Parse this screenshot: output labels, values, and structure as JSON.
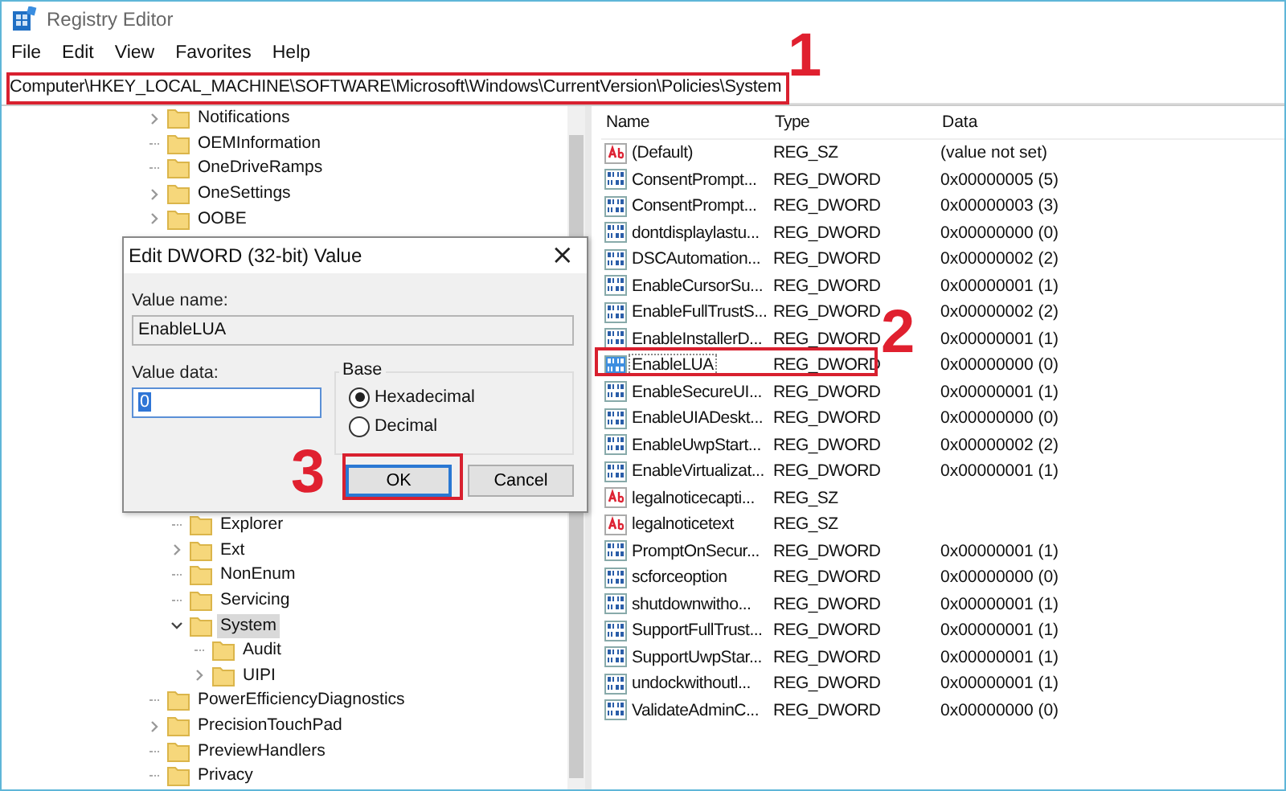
{
  "window": {
    "title": "Registry Editor"
  },
  "menu": [
    "File",
    "Edit",
    "View",
    "Favorites",
    "Help"
  ],
  "address": "Computer\\HKEY_LOCAL_MACHINE\\SOFTWARE\\Microsoft\\Windows\\CurrentVersion\\Policies\\System",
  "tree": {
    "top_items": [
      {
        "label": "Notifications",
        "expandable": true,
        "expanded": false,
        "selected": false
      },
      {
        "label": "OEMInformation",
        "expandable": false,
        "selected": false
      },
      {
        "label": "OneDriveRamps",
        "expandable": false,
        "selected": false
      },
      {
        "label": "OneSettings",
        "expandable": true,
        "expanded": false,
        "selected": false
      },
      {
        "label": "OOBE",
        "expandable": true,
        "expanded": false,
        "selected": false
      }
    ],
    "policies_children": [
      {
        "label": "Explorer",
        "expandable": false,
        "selected": false
      },
      {
        "label": "Ext",
        "expandable": true,
        "expanded": false,
        "selected": false
      },
      {
        "label": "NonEnum",
        "expandable": false,
        "selected": false
      },
      {
        "label": "Servicing",
        "expandable": false,
        "selected": false
      },
      {
        "label": "System",
        "expandable": true,
        "expanded": true,
        "selected": true,
        "children": [
          {
            "label": "Audit",
            "expandable": false,
            "selected": false
          },
          {
            "label": "UIPI",
            "expandable": true,
            "expanded": false,
            "selected": false
          }
        ]
      }
    ],
    "bottom_items": [
      {
        "label": "PowerEfficiencyDiagnostics",
        "expandable": false,
        "selected": false
      },
      {
        "label": "PrecisionTouchPad",
        "expandable": true,
        "expanded": false,
        "selected": false
      },
      {
        "label": "PreviewHandlers",
        "expandable": false,
        "selected": false
      },
      {
        "label": "Privacy",
        "expandable": false,
        "selected": false
      }
    ]
  },
  "values": {
    "columns": [
      "Name",
      "Type",
      "Data"
    ],
    "rows": [
      {
        "kind": "string",
        "name": "(Default)",
        "type": "REG_SZ",
        "data": "(value not set)",
        "selected": false
      },
      {
        "kind": "dword",
        "name": "ConsentPrompt...",
        "type": "REG_DWORD",
        "data": "0x00000005 (5)",
        "selected": false
      },
      {
        "kind": "dword",
        "name": "ConsentPrompt...",
        "type": "REG_DWORD",
        "data": "0x00000003 (3)",
        "selected": false
      },
      {
        "kind": "dword",
        "name": "dontdisplaylastu...",
        "type": "REG_DWORD",
        "data": "0x00000000 (0)",
        "selected": false
      },
      {
        "kind": "dword",
        "name": "DSCAutomation...",
        "type": "REG_DWORD",
        "data": "0x00000002 (2)",
        "selected": false
      },
      {
        "kind": "dword",
        "name": "EnableCursorSu...",
        "type": "REG_DWORD",
        "data": "0x00000001 (1)",
        "selected": false
      },
      {
        "kind": "dword",
        "name": "EnableFullTrustS...",
        "type": "REG_DWORD",
        "data": "0x00000002 (2)",
        "selected": false
      },
      {
        "kind": "dword",
        "name": "EnableInstallerD...",
        "type": "REG_DWORD",
        "data": "0x00000001 (1)",
        "selected": false
      },
      {
        "kind": "dword",
        "name": "EnableLUA",
        "type": "REG_DWORD",
        "data": "0x00000000 (0)",
        "selected": true
      },
      {
        "kind": "dword",
        "name": "EnableSecureUI...",
        "type": "REG_DWORD",
        "data": "0x00000001 (1)",
        "selected": false
      },
      {
        "kind": "dword",
        "name": "EnableUIADeskt...",
        "type": "REG_DWORD",
        "data": "0x00000000 (0)",
        "selected": false
      },
      {
        "kind": "dword",
        "name": "EnableUwpStart...",
        "type": "REG_DWORD",
        "data": "0x00000002 (2)",
        "selected": false
      },
      {
        "kind": "dword",
        "name": "EnableVirtualizat...",
        "type": "REG_DWORD",
        "data": "0x00000001 (1)",
        "selected": false
      },
      {
        "kind": "string",
        "name": "legalnoticecapti...",
        "type": "REG_SZ",
        "selected": false
      },
      {
        "kind": "string",
        "name": "legalnoticetext",
        "type": "REG_SZ",
        "selected": false
      },
      {
        "kind": "dword",
        "name": "PromptOnSecur...",
        "type": "REG_DWORD",
        "data": "0x00000001 (1)",
        "selected": false
      },
      {
        "kind": "dword",
        "name": "scforceoption",
        "type": "REG_DWORD",
        "data": "0x00000000 (0)",
        "selected": false
      },
      {
        "kind": "dword",
        "name": "shutdownwitho...",
        "type": "REG_DWORD",
        "data": "0x00000001 (1)",
        "selected": false
      },
      {
        "kind": "dword",
        "name": "SupportFullTrust...",
        "type": "REG_DWORD",
        "data": "0x00000001 (1)",
        "selected": false
      },
      {
        "kind": "dword",
        "name": "SupportUwpStar...",
        "type": "REG_DWORD",
        "data": "0x00000001 (1)",
        "selected": false
      },
      {
        "kind": "dword",
        "name": "undockwithoutl...",
        "type": "REG_DWORD",
        "data": "0x00000001 (1)",
        "selected": false
      },
      {
        "kind": "dword",
        "name": "ValidateAdminC...",
        "type": "REG_DWORD",
        "data": "0x00000000 (0)",
        "selected": false
      }
    ]
  },
  "dialog": {
    "title": "Edit DWORD (32-bit) Value",
    "close": "×",
    "value_name_label": "Value name:",
    "value_name": "EnableLUA",
    "value_data_label": "Value data:",
    "value_data": "0",
    "base_label": "Base",
    "base_options": [
      {
        "label": "Hexadecimal",
        "selected": true
      },
      {
        "label": "Decimal",
        "selected": false
      }
    ],
    "buttons": [
      {
        "label": "OK",
        "focused": true
      },
      {
        "label": "Cancel",
        "focused": false
      }
    ]
  },
  "annotations": [
    {
      "label": "1"
    },
    {
      "label": "2"
    },
    {
      "label": "3"
    }
  ]
}
